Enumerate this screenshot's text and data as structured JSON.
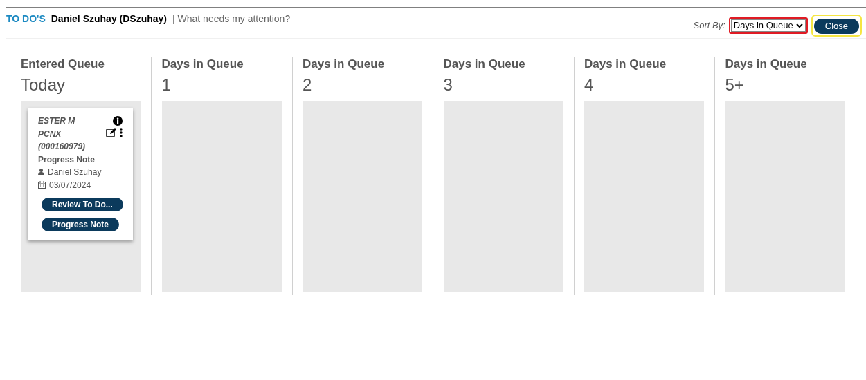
{
  "header": {
    "title": "TO DO'S",
    "user": "Daniel Szuhay (DSzuhay)",
    "subtitle": "| What needs my attention?"
  },
  "sort": {
    "label": "Sort By:",
    "value": "Days in Queue"
  },
  "close_button": "Close",
  "columns": [
    {
      "label": "Entered Queue",
      "value": "Today",
      "cards": [
        {
          "client_lines": [
            "ESTER M",
            "PCNX",
            "(000160979)"
          ],
          "document": "Progress Note",
          "staff": "Daniel Szuhay",
          "date": "03/07/2024",
          "buttons": [
            "Review To Do...",
            "Progress Note"
          ]
        }
      ]
    },
    {
      "label": "Days in Queue",
      "value": "1"
    },
    {
      "label": "Days in Queue",
      "value": "2"
    },
    {
      "label": "Days in Queue",
      "value": "3"
    },
    {
      "label": "Days in Queue",
      "value": "4"
    },
    {
      "label": "Days in Queue",
      "value": "5+"
    }
  ]
}
